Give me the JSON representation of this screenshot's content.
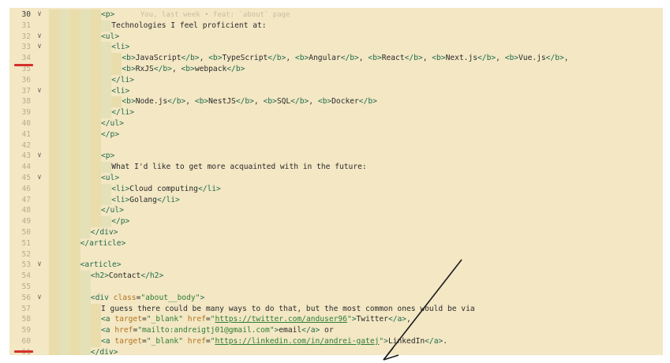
{
  "editor": {
    "current_line": 30,
    "blame_annotation": "You, last week • feat: `about` page",
    "lines": [
      {
        "num": "30",
        "fold": true,
        "indent": 5,
        "html": "<span class=\"tag\">&lt;p&gt;</span>"
      },
      {
        "num": "31",
        "fold": false,
        "indent": 6,
        "html": "Technologies I feel proficient at:"
      },
      {
        "num": "32",
        "fold": true,
        "indent": 5,
        "html": "<span class=\"tag\">&lt;ul&gt;</span>"
      },
      {
        "num": "33",
        "fold": true,
        "indent": 6,
        "html": "<span class=\"tag\">&lt;li&gt;</span>"
      },
      {
        "num": "34",
        "fold": false,
        "indent": 7,
        "html": "<span class=\"tag\">&lt;b&gt;</span>JavaScript<span class=\"tag\">&lt;/b&gt;</span>, <span class=\"tag\">&lt;b&gt;</span>TypeScript<span class=\"tag\">&lt;/b&gt;</span>, <span class=\"tag\">&lt;b&gt;</span>Angular<span class=\"tag\">&lt;/b&gt;</span>, <span class=\"tag\">&lt;b&gt;</span>React<span class=\"tag\">&lt;/b&gt;</span>, <span class=\"tag\">&lt;b&gt;</span>Next.js<span class=\"tag\">&lt;/b&gt;</span>, <span class=\"tag\">&lt;b&gt;</span>Vue.js<span class=\"tag\">&lt;/b&gt;</span>,"
      },
      {
        "num": "35",
        "fold": false,
        "indent": 7,
        "html": "<span class=\"tag\">&lt;b&gt;</span>RxJS<span class=\"tag\">&lt;/b&gt;</span>, <span class=\"tag\">&lt;b&gt;</span>webpack<span class=\"tag\">&lt;/b&gt;</span>"
      },
      {
        "num": "36",
        "fold": false,
        "indent": 6,
        "html": "<span class=\"tag\">&lt;/li&gt;</span>"
      },
      {
        "num": "37",
        "fold": true,
        "indent": 6,
        "html": "<span class=\"tag\">&lt;li&gt;</span>"
      },
      {
        "num": "38",
        "fold": false,
        "indent": 7,
        "html": "<span class=\"tag\">&lt;b&gt;</span>Node.js<span class=\"tag\">&lt;/b&gt;</span>, <span class=\"tag\">&lt;b&gt;</span>NestJS<span class=\"tag\">&lt;/b&gt;</span>, <span class=\"tag\">&lt;b&gt;</span>SQL<span class=\"tag\">&lt;/b&gt;</span>, <span class=\"tag\">&lt;b&gt;</span>Docker<span class=\"tag\">&lt;/b&gt;</span>"
      },
      {
        "num": "39",
        "fold": false,
        "indent": 6,
        "html": "<span class=\"tag\">&lt;/li&gt;</span>"
      },
      {
        "num": "40",
        "fold": false,
        "indent": 5,
        "html": "<span class=\"tag\">&lt;/ul&gt;</span>"
      },
      {
        "num": "41",
        "fold": false,
        "indent": 5,
        "html": "<span class=\"tag\">&lt;/p&gt;</span>"
      },
      {
        "num": "42",
        "fold": false,
        "indent": 5,
        "html": ""
      },
      {
        "num": "43",
        "fold": true,
        "indent": 5,
        "html": "<span class=\"tag\">&lt;p&gt;</span>"
      },
      {
        "num": "44",
        "fold": false,
        "indent": 6,
        "html": "What I'd like to get more acquainted with in the future:"
      },
      {
        "num": "45",
        "fold": true,
        "indent": 5,
        "html": "<span class=\"tag\">&lt;ul&gt;</span>"
      },
      {
        "num": "46",
        "fold": false,
        "indent": 6,
        "html": "<span class=\"tag\">&lt;li&gt;</span>Cloud computing<span class=\"tag\">&lt;/li&gt;</span>"
      },
      {
        "num": "47",
        "fold": false,
        "indent": 6,
        "html": "<span class=\"tag\">&lt;li&gt;</span>Golang<span class=\"tag\">&lt;/li&gt;</span>"
      },
      {
        "num": "48",
        "fold": false,
        "indent": 5,
        "html": "<span class=\"tag\">&lt;/ul&gt;</span>"
      },
      {
        "num": "49",
        "fold": false,
        "indent": 6,
        "html": "<span class=\"tag\">&lt;/p&gt;</span>"
      },
      {
        "num": "50",
        "fold": false,
        "indent": 4,
        "html": "<span class=\"tag\">&lt;/div&gt;</span>"
      },
      {
        "num": "51",
        "fold": false,
        "indent": 3,
        "html": "<span class=\"tag\">&lt;/article&gt;</span>"
      },
      {
        "num": "52",
        "fold": false,
        "indent": 3,
        "html": ""
      },
      {
        "num": "53",
        "fold": true,
        "indent": 3,
        "html": "<span class=\"tag\">&lt;article&gt;</span>"
      },
      {
        "num": "54",
        "fold": false,
        "indent": 4,
        "html": "<span class=\"tag\">&lt;h2&gt;</span>Contact<span class=\"tag\">&lt;/h2&gt;</span>"
      },
      {
        "num": "55",
        "fold": false,
        "indent": 4,
        "html": ""
      },
      {
        "num": "56",
        "fold": true,
        "indent": 4,
        "html": "<span class=\"tag\">&lt;div </span><span class=\"attr\">class</span>=<span class=\"str\">\"about__body\"</span><span class=\"tag\">&gt;</span>"
      },
      {
        "num": "57",
        "fold": false,
        "indent": 5,
        "html": "I guess there could be many ways to do that, but the most common ones would be via"
      },
      {
        "num": "58",
        "fold": false,
        "indent": 5,
        "html": "<span class=\"tag\">&lt;a </span><span class=\"attr\">target</span>=<span class=\"str\">\"_blank\"</span> <span class=\"attr\">href</span>=<span class=\"str\">\"</span><span class=\"url\">https://twitter.com/anduser96</span><span class=\"str\">\"</span><span class=\"tag\">&gt;</span>Twitter<span class=\"tag\">&lt;/a&gt;</span>,"
      },
      {
        "num": "59",
        "fold": false,
        "indent": 5,
        "html": "<span class=\"tag\">&lt;a </span><span class=\"attr\">href</span>=<span class=\"str\">\"mailto:andreigtj01@gmail.com\"</span><span class=\"tag\">&gt;</span>email<span class=\"tag\">&lt;/a&gt;</span> or"
      },
      {
        "num": "60",
        "fold": false,
        "indent": 5,
        "html": "<span class=\"tag\">&lt;a </span><span class=\"attr\">target</span>=<span class=\"str\">\"_blank\"</span> <span class=\"attr\">href</span>=<span class=\"str\">\"</span><span class=\"url\">https://linkedin.com/in/andrei-gatej</span><span class=\"str\">\"</span><span class=\"tag\">&gt;</span>LinkedIn<span class=\"tag\">&lt;/a&gt;</span>."
      },
      {
        "num": "61",
        "fold": false,
        "indent": 4,
        "html": "<span class=\"tag\">&lt;/div&gt;</span>"
      }
    ]
  },
  "annotations": {
    "color": "#d4302b"
  }
}
